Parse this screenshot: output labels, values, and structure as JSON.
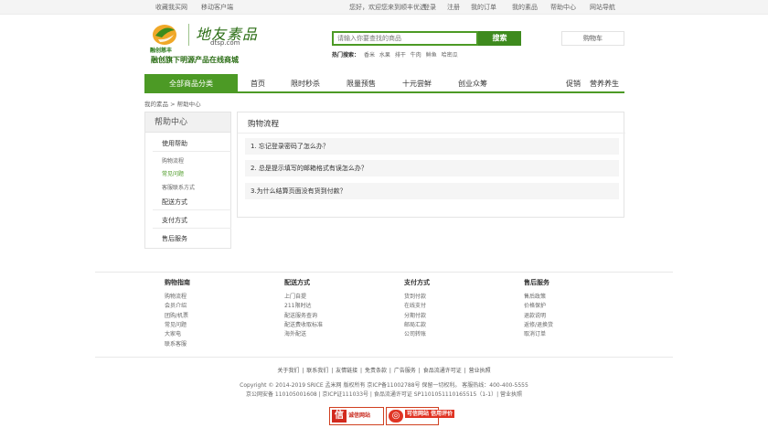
{
  "topbar": {
    "left": [
      "收藏我买网",
      "移动客户端"
    ],
    "welcome": "您好，欢迎您来到顺丰优选",
    "login": "登录",
    "register": "注册",
    "orders": "我的订单",
    "account": "我的素品",
    "help": "帮助中心",
    "sitemap": "网站导航"
  },
  "header": {
    "logo_sub": "融创慈丰",
    "logo_cn": "地友素品",
    "logo_domain": "dtsp.com",
    "slogan": "融创旗下明源产品在线商城",
    "search_placeholder": "请输入你要查找的商品",
    "search_button": "搜索",
    "hot_label": "热门搜索：",
    "hot_items": [
      "香米",
      "水果",
      "排干",
      "牛肉",
      "鲜鱼",
      "哈密瓜"
    ],
    "cart": "购物车"
  },
  "nav": {
    "all": "全部商品分类",
    "items": [
      "首页",
      "限时秒杀",
      "限量预售",
      "十元尝鲜",
      "创业众筹"
    ],
    "right": [
      "促销",
      "营养养生"
    ]
  },
  "breadcrumb": "我的素品 > 帮助中心",
  "sidebar": {
    "title": "帮助中心",
    "cats": [
      "使用帮助",
      "配送方式",
      "支付方式",
      "售后服务"
    ],
    "subs": [
      "购物流程",
      "常见问题",
      "客服联系方式"
    ]
  },
  "main": {
    "title": "购物流程",
    "faqs": [
      "1. 忘记登录密码了怎么办？",
      "2. 总是提示填写的邮箱格式有误怎么办？",
      "3.为什么结算页面没有货到付款？"
    ]
  },
  "footer": {
    "cols": [
      {
        "title": "购物指南",
        "items": [
          "购物流程",
          "会员介绍",
          "团购/机票",
          "常见问题",
          "大家电",
          "联系客服"
        ]
      },
      {
        "title": "配送方式",
        "items": [
          "上门自提",
          "211限时达",
          "配送服务查询",
          "配送费收取标准",
          "海外配送"
        ]
      },
      {
        "title": "支付方式",
        "items": [
          "货到付款",
          "在线支付",
          "分期付款",
          "邮局汇款",
          "公司转账"
        ]
      },
      {
        "title": "售后服务",
        "items": [
          "售后政策",
          "价格保护",
          "退款说明",
          "返修/退换货",
          "取消订单"
        ]
      }
    ],
    "links": [
      "关于我们",
      "联系我们",
      "友情链接",
      "免责条款",
      "广告服务",
      "食品流通许可证",
      "营业执照"
    ],
    "copy1": "Copyright © 2014-2019 SRICE 孟米网 版权所有 京ICP备11002788号 保留一切权利。 客服热线：400-400-5555",
    "copy2": "京公网安备 110105001608 | 京ICP证111033号 | 食品流通许可证 SP1101051110165515（1-1）| 营业执照",
    "badge1": "诚信网站",
    "badge2": "可信网站 信用评价"
  }
}
